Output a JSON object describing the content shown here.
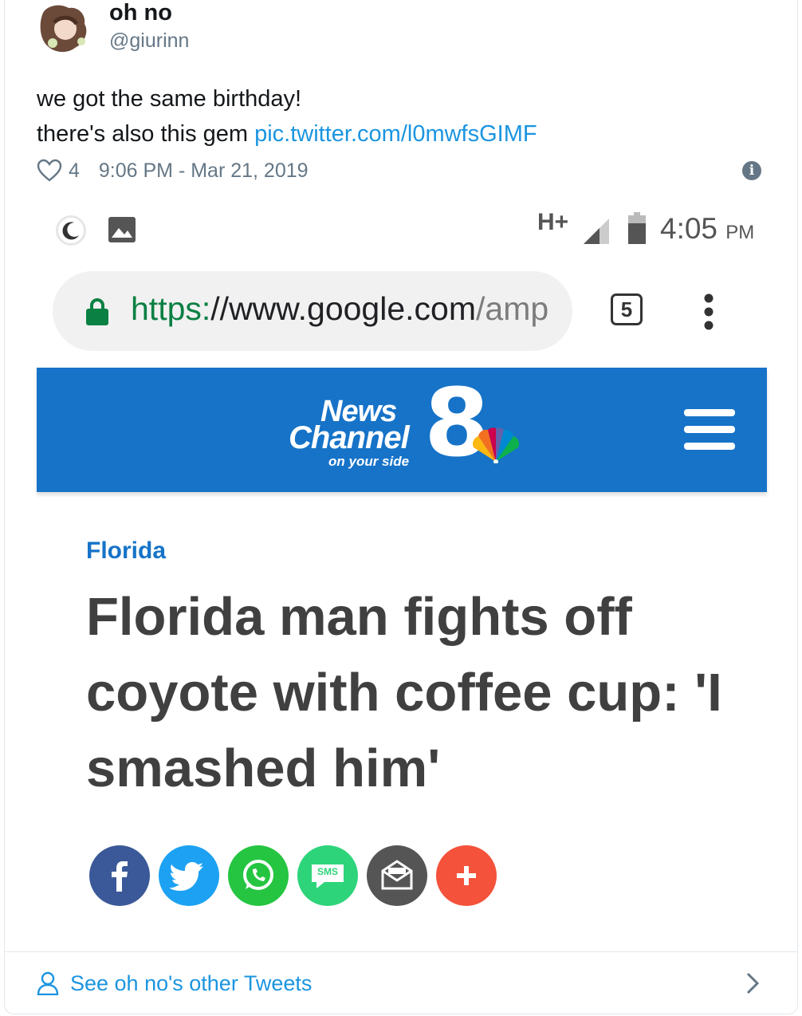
{
  "tweet": {
    "display_name": "oh no",
    "handle": "@giurinn",
    "text_line1": "we got the same birthday!",
    "text_line2_prefix": "there's also this gem ",
    "link": "pic.twitter.com/l0mwfsGIMF",
    "like_count": "4",
    "timestamp": "9:06 PM - Mar 21, 2019"
  },
  "screenshot": {
    "status_bar": {
      "network": "H+",
      "time": "4:05",
      "ampm": "PM"
    },
    "browser": {
      "url_scheme": "https:",
      "url_host": "//www.google.com",
      "url_rest": "/amp",
      "tab_count": "5"
    },
    "site": {
      "logo_line1": "News",
      "logo_line2": "Channel",
      "logo_numeral": "8",
      "logo_tagline": "on your side",
      "section": "Florida",
      "headline": "Florida man fights off coyote with coffee cup: 'I smashed him'"
    },
    "share_buttons": [
      {
        "name": "facebook",
        "color": "#3b5998"
      },
      {
        "name": "twitter",
        "color": "#1da1f2"
      },
      {
        "name": "whatsapp",
        "color": "#25c541"
      },
      {
        "name": "sms",
        "color": "#2ed47a"
      },
      {
        "name": "email",
        "color": "#555555"
      },
      {
        "name": "more",
        "color": "#f4523b"
      }
    ],
    "sms_label": "SMS"
  },
  "footer": {
    "label": "See oh no's other Tweets"
  },
  "colors": {
    "link": "#1b95e0",
    "brand_blue": "#1673c8",
    "meta_gray": "#657786"
  }
}
